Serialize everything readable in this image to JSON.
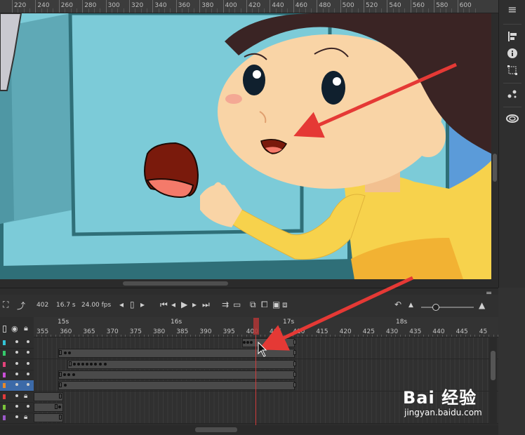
{
  "ruler": {
    "labels": [
      "220",
      "240",
      "260",
      "280",
      "300",
      "320",
      "340",
      "360",
      "380",
      "400",
      "420",
      "440",
      "460",
      "480",
      "500",
      "520",
      "540",
      "560",
      "580",
      "600"
    ]
  },
  "right_toolbar": {
    "icons": [
      "align-icon",
      "info-icon",
      "transform-icon",
      "motion-editor-icon",
      "cc-libraries-icon"
    ]
  },
  "timeline": {
    "frame_number": "402",
    "time": "16.7 s",
    "fps": "24.00 fps",
    "seconds_markers": [
      "15s",
      "16s",
      "17s",
      "18s"
    ],
    "frame_numbers": [
      "355",
      "360",
      "365",
      "370",
      "375",
      "380",
      "385",
      "390",
      "395",
      "400",
      "405",
      "410",
      "415",
      "420",
      "425",
      "430",
      "435",
      "440",
      "445",
      "45"
    ]
  },
  "layers": [
    {
      "color": "#34c3d6",
      "locked": false
    },
    {
      "color": "#36c96b",
      "locked": false
    },
    {
      "color": "#e2427a",
      "locked": false
    },
    {
      "color": "#c94fd6",
      "locked": false
    },
    {
      "color": "#e8892a",
      "locked": false,
      "selected": true
    },
    {
      "color": "#e23b3b",
      "locked": true
    },
    {
      "color": "#7ac43a",
      "locked": false
    },
    {
      "color": "#9b59c9",
      "locked": true
    }
  ],
  "watermark": {
    "main": "Bai 经验",
    "sub": "jingyan.baidu.com"
  },
  "colors": {
    "annotation_arrow": "#e53935",
    "playhead": "#d03b3b",
    "selected_layer": "#3c6aa8"
  }
}
